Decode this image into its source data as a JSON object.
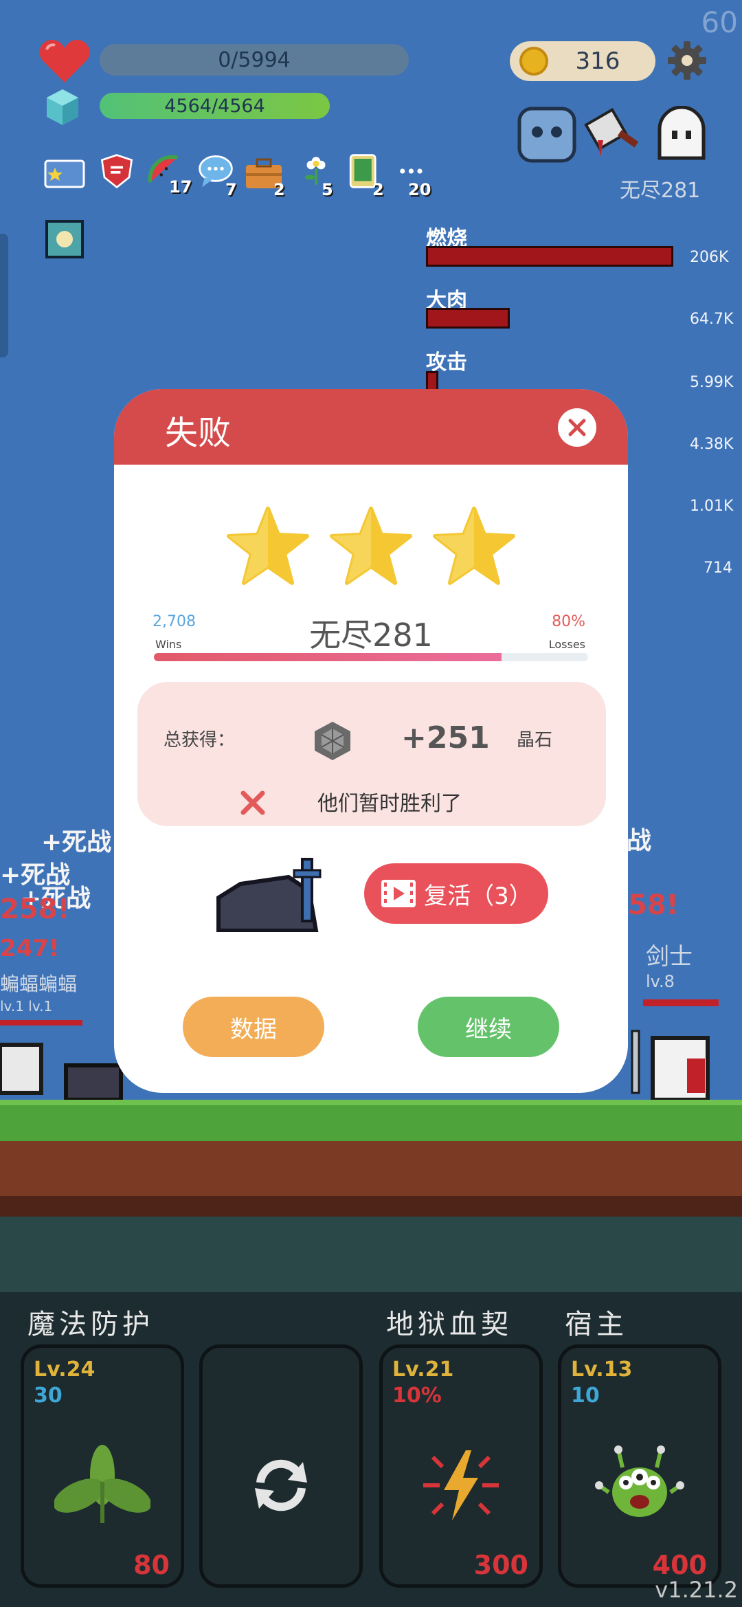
{
  "fps": "60",
  "hud": {
    "hp": "0/5994",
    "shield": "4564/4564",
    "coins": "316"
  },
  "stats": [
    {
      "icon": "card-icon",
      "count": ""
    },
    {
      "icon": "shield-badge-icon",
      "count": ""
    },
    {
      "icon": "watermelon-icon",
      "count": "17"
    },
    {
      "icon": "chat-bubble-icon",
      "count": "7"
    },
    {
      "icon": "briefcase-icon",
      "count": "2"
    },
    {
      "icon": "flower-icon",
      "count": "5"
    },
    {
      "icon": "phone-icon",
      "count": "2"
    },
    {
      "icon": "more-icon",
      "count": "20"
    }
  ],
  "enemy_label": "无尽281",
  "damage": [
    {
      "name": "燃烧",
      "value": "206K",
      "ratio": 1.0
    },
    {
      "name": "大肉",
      "value": "64.7K",
      "ratio": 0.31
    },
    {
      "name": "攻击",
      "value": "5.99K",
      "ratio": 0.05
    },
    {
      "name": "",
      "value": "4.38K",
      "ratio": 0.0
    },
    {
      "name": "",
      "value": "1.01K",
      "ratio": 0.0
    },
    {
      "name": "",
      "value": "714",
      "ratio": 0.0
    }
  ],
  "battle": {
    "float_left_1": "+死战",
    "float_left_2": "+死战",
    "float_left_3": "+死战",
    "float_num_left": "258!",
    "float_num_left2": "247!",
    "float_right_1": "战",
    "float_num_right": "58!",
    "enemy_name_left": "蝙蝠蝙蝠",
    "enemy_lv_left": "lv.1 lv.1",
    "hero_name": "剑士",
    "hero_lv": "lv.8"
  },
  "dialog": {
    "title": "失败",
    "stars": 3,
    "wins_count": "2,708",
    "wins_label": "Wins",
    "losses_pct": "80%",
    "losses_label": "Losses",
    "level_name": "无尽281",
    "progress": 0.8,
    "reward_label": "总获得：",
    "reward_amount": "+251",
    "reward_unit": "晶石",
    "result_message": "他们暂时胜利了",
    "revive_label": "复活（3）",
    "data_button": "数据",
    "continue_button": "继续"
  },
  "skills": {
    "names": [
      "魔法防护",
      "地狱血契",
      "宿主"
    ],
    "cards": [
      {
        "level": "Lv.24",
        "sub": "30",
        "sub_color": "#3da7d8",
        "cost": "80",
        "icon": "leaf-icon"
      },
      {
        "level": "",
        "sub": "",
        "sub_color": "#3da7d8",
        "cost": "",
        "icon": "refresh-icon"
      },
      {
        "level": "Lv.21",
        "sub": "10%",
        "sub_color": "#d8353a",
        "cost": "300",
        "icon": "lightning-icon"
      },
      {
        "level": "Lv.13",
        "sub": "10",
        "sub_color": "#3da7d8",
        "cost": "400",
        "icon": "monster-icon"
      }
    ]
  },
  "version": "v1.21.2"
}
